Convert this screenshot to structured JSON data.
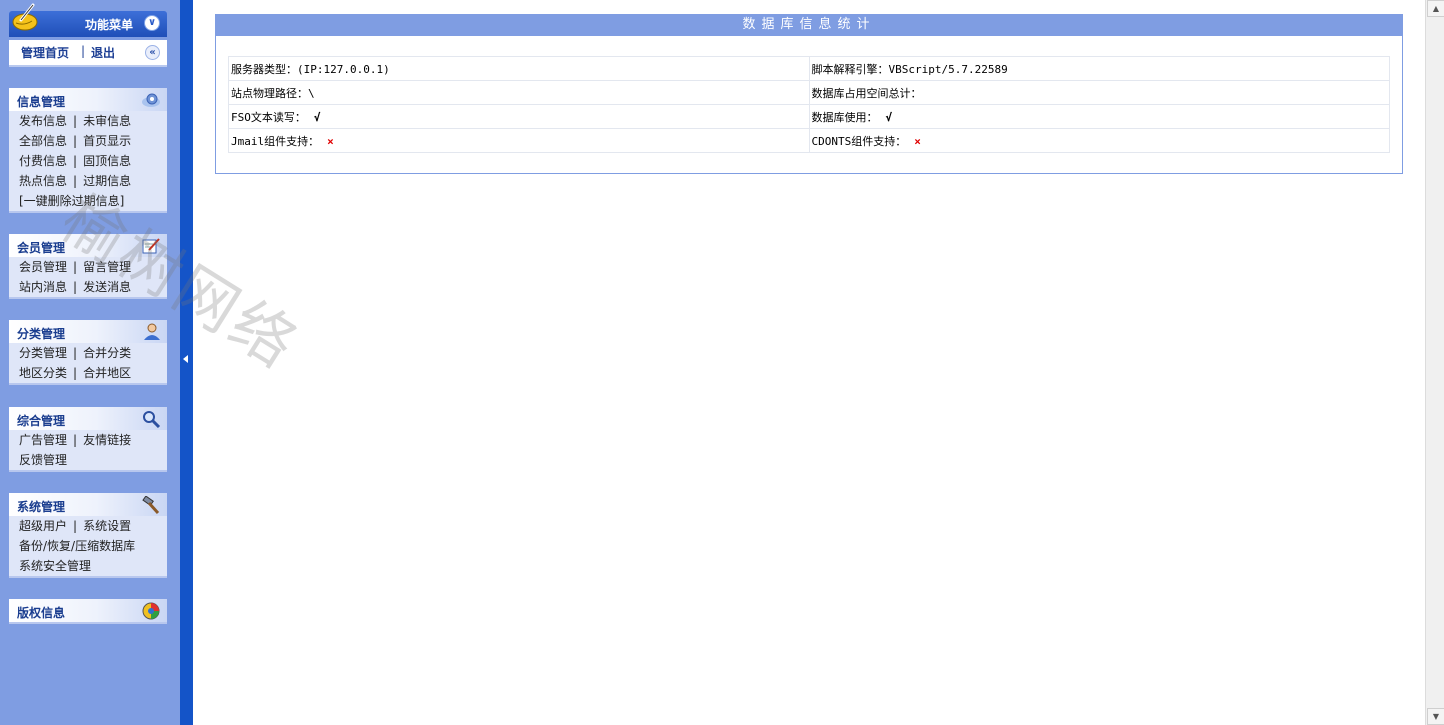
{
  "menu": {
    "title": "功能菜单",
    "collapse_icon": "double-chevron-down",
    "home_link": "管理首页",
    "separator": "|",
    "logout_link": "退出",
    "shrink_icon": "double-chevron-left"
  },
  "sections": {
    "info": {
      "title": "信息管理",
      "icon": "gear-cloud-icon",
      "items": [
        "发布信息",
        "未审信息",
        "全部信息",
        "首页显示",
        "付费信息",
        "固顶信息",
        "热点信息",
        "过期信息",
        "[一键删除过期信息]"
      ]
    },
    "member": {
      "title": "会员管理",
      "icon": "notebook-pen-icon",
      "items": [
        "会员管理",
        "留言管理",
        "站内消息",
        "发送消息"
      ]
    },
    "category": {
      "title": "分类管理",
      "icon": "user-icon",
      "items": [
        "分类管理",
        "合并分类",
        "地区分类",
        "合并地区"
      ]
    },
    "general": {
      "title": "综合管理",
      "icon": "magnifier-icon",
      "items": [
        "广告管理",
        "友情链接",
        "反馈管理"
      ]
    },
    "system": {
      "title": "系统管理",
      "icon": "hammer-icon",
      "items": [
        "超级用户",
        "系统设置",
        "备份/恢复/压缩数据库",
        "系统安全管理"
      ]
    },
    "copyright": {
      "title": "版权信息",
      "icon": "colorful-globe-icon"
    }
  },
  "main": {
    "title": "数据库信息统计",
    "rows": [
      {
        "left_label": "服务器类型：",
        "left_value": "(IP:127.0.0.1)",
        "right_label": "脚本解释引擎：",
        "right_value": "VBScript/5.7.22589"
      },
      {
        "left_label": "站点物理路径：",
        "left_value": "\\",
        "right_label": "数据库占用空间总计：",
        "right_value": ""
      },
      {
        "left_label": "FSO文本读写：",
        "left_value": "√",
        "right_label": "数据库使用：",
        "right_value": "√"
      },
      {
        "left_label": "Jmail组件支持：",
        "left_value": "×",
        "right_label": "CDONTS组件支持：",
        "right_value": "×"
      }
    ]
  },
  "watermark": "榆树网络",
  "colors": {
    "sidebar_bg": "#7f9de2",
    "splitter": "#1454c8",
    "header_blue": "#1f4fb8",
    "section_title": "#1a3d8f",
    "fail_mark": "#e00000"
  }
}
